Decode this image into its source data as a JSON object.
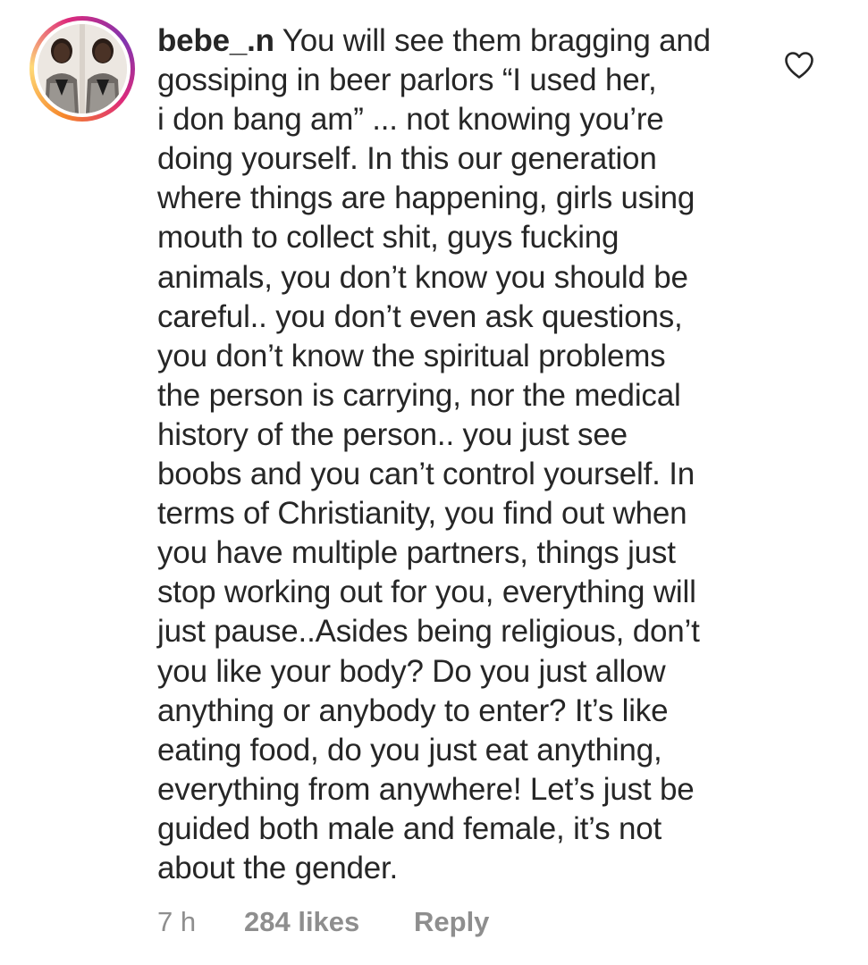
{
  "comment": {
    "username": "bebe_.n",
    "lines": [
      "You will see them bragging and",
      "gossiping in beer parlors “I used her,",
      "i don bang am” ... not knowing you’re",
      "doing yourself. In this our generation",
      "where things are happening, girls using",
      "mouth to collect shit, guys fucking",
      "animals, you don’t know you should be",
      "careful.. you don’t even ask questions,",
      "you don’t know the spiritual problems",
      "the person is carrying, nor the medical",
      "history of the person.. you just see",
      "boobs and you can’t control yourself. In",
      "terms of Christianity, you find out when",
      "you have multiple partners, things just",
      "stop working out for you, everything will",
      "just pause..Asides being religious, don’t",
      "you like your body? Do you just allow",
      "anything or anybody to enter? It’s like",
      "eating food, do you just eat anything,",
      "everything from anywhere! Let’s just be",
      "guided both male and female, it’s not",
      "about the gender."
    ],
    "time": "7 h",
    "likes": "284 likes",
    "reply_label": "Reply",
    "icons": {
      "like": "heart-outline-icon"
    },
    "colors": {
      "text": "#262626",
      "meta": "#8e8e8e",
      "story_ring_start": "#f58529",
      "story_ring_end": "#dd2a7b"
    }
  }
}
